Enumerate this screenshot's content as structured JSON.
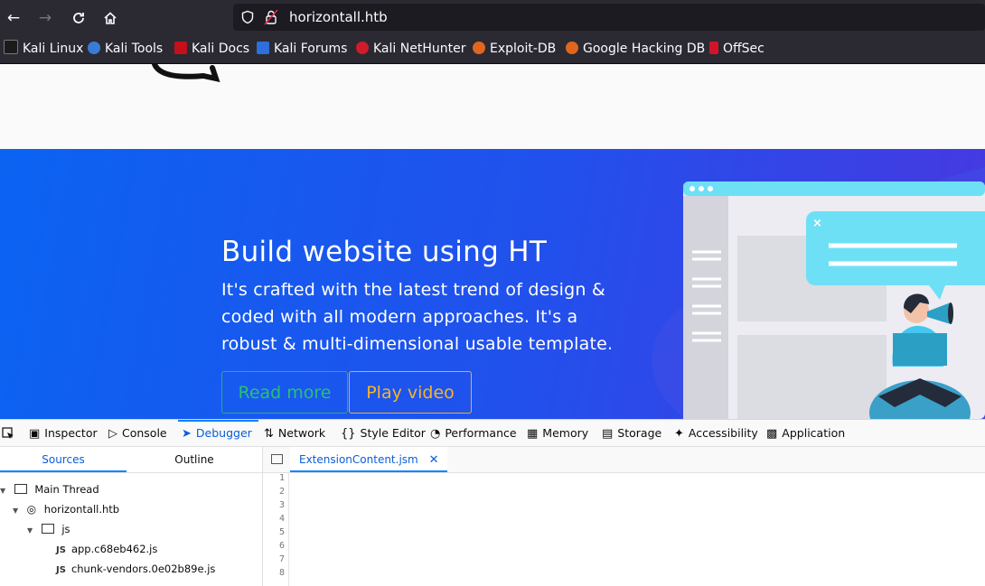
{
  "browser": {
    "url": "horizontall.htb",
    "bookmarks": [
      "Kali Linux",
      "Kali Tools",
      "Kali Docs",
      "Kali Forums",
      "Kali NetHunter",
      "Exploit-DB",
      "Google Hacking DB",
      "OffSec"
    ]
  },
  "hero": {
    "title": "Build website using HT",
    "description": "It's crafted with the latest trend of design & coded with all modern approaches. It's a robust & multi-dimensional usable template.",
    "read_more": "Read more",
    "play_video": "Play video"
  },
  "devtools": {
    "tabs": [
      "Inspector",
      "Console",
      "Debugger",
      "Network",
      "Style Editor",
      "Performance",
      "Memory",
      "Storage",
      "Accessibility",
      "Application"
    ],
    "sources_tab": "Sources",
    "outline_tab": "Outline",
    "tree": {
      "main_thread": "Main Thread",
      "host": "horizontall.htb",
      "folder": "js",
      "js_label": "JS",
      "files": [
        "app.c68eb462.js",
        "chunk-vendors.0e02b89e.js"
      ]
    },
    "open_file": "ExtensionContent.jsm",
    "line_numbers": [
      "1",
      "2",
      "3",
      "4",
      "5",
      "6",
      "7",
      "8"
    ]
  },
  "colors": {
    "hero_gradient_start": "#0b63f2",
    "hero_gradient_end": "#4838e0",
    "read_more": "#29c16e",
    "play_video": "#f5b625",
    "devtools_accent": "#0a84ff"
  }
}
